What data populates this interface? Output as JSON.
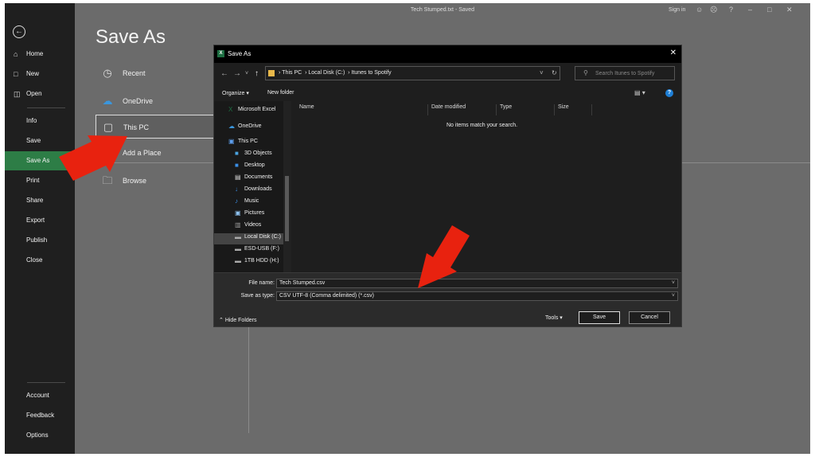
{
  "window": {
    "doc_title": "Tech Stumped.txt  -  Saved",
    "sign_in": "Sign in",
    "caption_icons": [
      "smile-icon",
      "frown-icon",
      "help-icon",
      "minimize-icon",
      "maximize-icon",
      "close-icon"
    ]
  },
  "sidebar": {
    "back_icon": "back-arrow-icon",
    "items_top": [
      {
        "label": "Home",
        "icon": "home-icon"
      },
      {
        "label": "New",
        "icon": "new-document-icon"
      },
      {
        "label": "Open",
        "icon": "folder-open-icon"
      }
    ],
    "items_mid": [
      "Info",
      "Save",
      "Save As",
      "Print",
      "Share",
      "Export",
      "Publish",
      "Close"
    ],
    "active": "Save As",
    "items_bottom": [
      "Account",
      "Feedback",
      "Options"
    ]
  },
  "pane": {
    "title": "Save As",
    "locations": [
      {
        "label": "Recent",
        "icon": "clock-icon"
      },
      {
        "label": "OneDrive",
        "icon": "cloud-icon"
      },
      {
        "label": "This PC",
        "icon": "computer-icon"
      },
      {
        "label": "Add a Place",
        "icon": "globe-icon"
      },
      {
        "label": "Browse",
        "icon": "folder-icon"
      }
    ],
    "selected": "This PC"
  },
  "dialog": {
    "title": "Save As",
    "path": [
      "This PC",
      "Local Disk (C:)",
      "Itunes to Spotify"
    ],
    "search_placeholder": "Search Itunes to Spotify",
    "organize": "Organize",
    "new_folder": "New folder",
    "tree": [
      {
        "label": "Microsoft Excel",
        "color": "#1d6f42"
      },
      {
        "label": "OneDrive",
        "color": "#3a96dd"
      },
      {
        "label": "This PC",
        "color": "#5ea0ef"
      },
      {
        "label": "3D Objects",
        "color": "#4aa3e0"
      },
      {
        "label": "Desktop",
        "color": "#3a8ee6"
      },
      {
        "label": "Documents",
        "color": "#d8d8d8"
      },
      {
        "label": "Downloads",
        "color": "#3a8ee6"
      },
      {
        "label": "Music",
        "color": "#3a8ee6"
      },
      {
        "label": "Pictures",
        "color": "#8fc3f2"
      },
      {
        "label": "Videos",
        "color": "#9a9a9a"
      },
      {
        "label": "Local Disk (C:)",
        "color": "#aaaaaa"
      },
      {
        "label": "ESD-USB (F:)",
        "color": "#aaaaaa"
      },
      {
        "label": "1TB HDD (H:)",
        "color": "#aaaaaa"
      }
    ],
    "tree_selected": "Local Disk (C:)",
    "columns": [
      "Name",
      "Date modified",
      "Type",
      "Size"
    ],
    "empty_message": "No items match your search.",
    "file_name_label": "File name:",
    "file_name": "Tech Stumped.csv",
    "save_type_label": "Save as type:",
    "save_type": "CSV UTF-8 (Comma delimited) (*.csv)",
    "hide_folders": "Hide Folders",
    "tools": "Tools",
    "save_button": "Save",
    "cancel_button": "Cancel"
  },
  "annotations": {
    "arrow_color": "#e8220f"
  }
}
